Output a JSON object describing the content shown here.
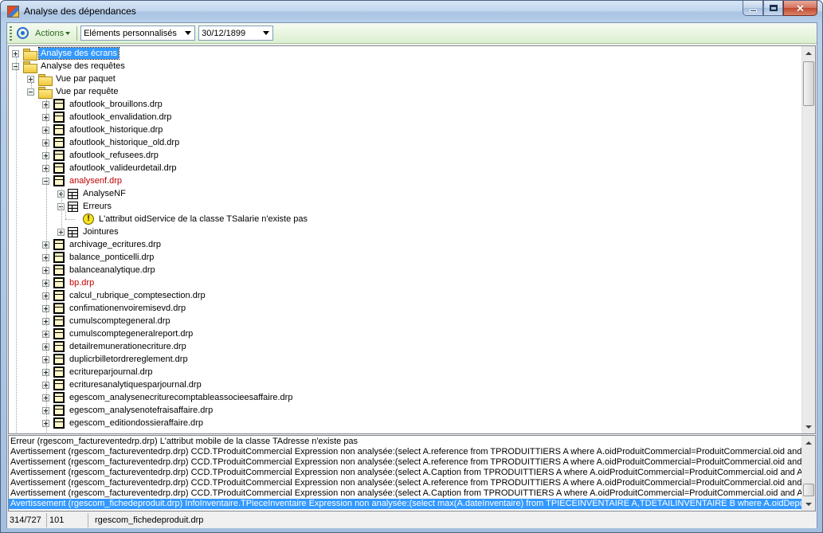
{
  "window": {
    "title": "Analyse des dépendances"
  },
  "toolbar": {
    "actions_label": "Actions",
    "filter_value": "Eléments personnalisés",
    "date_value": "30/12/1899"
  },
  "tree": {
    "nodes": [
      {
        "label": "Analyse des écrans",
        "level": 0,
        "expander": "plus",
        "icon": "folder",
        "selected": true
      },
      {
        "label": "Analyse des requêtes",
        "level": 0,
        "expander": "minus",
        "icon": "folder"
      },
      {
        "label": "Vue par paquet",
        "level": 1,
        "expander": "plus",
        "icon": "folder"
      },
      {
        "label": "Vue par requête",
        "level": 1,
        "expander": "minus",
        "icon": "folder"
      },
      {
        "label": "afoutlook_brouillons.drp",
        "level": 2,
        "expander": "plus",
        "icon": "table"
      },
      {
        "label": "afoutlook_envalidation.drp",
        "level": 2,
        "expander": "plus",
        "icon": "table"
      },
      {
        "label": "afoutlook_historique.drp",
        "level": 2,
        "expander": "plus",
        "icon": "table"
      },
      {
        "label": "afoutlook_historique_old.drp",
        "level": 2,
        "expander": "plus",
        "icon": "table"
      },
      {
        "label": "afoutlook_refusees.drp",
        "level": 2,
        "expander": "plus",
        "icon": "table"
      },
      {
        "label": "afoutlook_valideurdetail.drp",
        "level": 2,
        "expander": "plus",
        "icon": "table"
      },
      {
        "label": "analysenf.drp",
        "level": 2,
        "expander": "minus",
        "icon": "table",
        "red": true
      },
      {
        "label": "AnalyseNF",
        "level": 3,
        "expander": "plus",
        "icon": "grid"
      },
      {
        "label": "Erreurs",
        "level": 3,
        "expander": "minus",
        "icon": "grid"
      },
      {
        "label": "L'attribut oidService de la classe TSalarie n'existe pas",
        "level": 4,
        "expander": "none",
        "icon": "warning"
      },
      {
        "label": "Jointures",
        "level": 3,
        "expander": "plus",
        "icon": "grid"
      },
      {
        "label": "archivage_ecritures.drp",
        "level": 2,
        "expander": "plus",
        "icon": "table"
      },
      {
        "label": "balance_ponticelli.drp",
        "level": 2,
        "expander": "plus",
        "icon": "table"
      },
      {
        "label": "balanceanalytique.drp",
        "level": 2,
        "expander": "plus",
        "icon": "table"
      },
      {
        "label": "bp.drp",
        "level": 2,
        "expander": "plus",
        "icon": "table",
        "red": true
      },
      {
        "label": "calcul_rubrique_comptesection.drp",
        "level": 2,
        "expander": "plus",
        "icon": "table"
      },
      {
        "label": "confimationenvoiremisevd.drp",
        "level": 2,
        "expander": "plus",
        "icon": "table"
      },
      {
        "label": "cumulscomptegeneral.drp",
        "level": 2,
        "expander": "plus",
        "icon": "table"
      },
      {
        "label": "cumulscomptegeneralreport.drp",
        "level": 2,
        "expander": "plus",
        "icon": "table"
      },
      {
        "label": "detailremunerationecriture.drp",
        "level": 2,
        "expander": "plus",
        "icon": "table"
      },
      {
        "label": "duplicrbilletordrereglement.drp",
        "level": 2,
        "expander": "plus",
        "icon": "table"
      },
      {
        "label": "ecritureparjournal.drp",
        "level": 2,
        "expander": "plus",
        "icon": "table"
      },
      {
        "label": "ecrituresanalytiquesparjournal.drp",
        "level": 2,
        "expander": "plus",
        "icon": "table"
      },
      {
        "label": "egescom_analysenecriturecomptableassocieesaffaire.drp",
        "level": 2,
        "expander": "plus",
        "icon": "table"
      },
      {
        "label": "egescom_analysenotefraisaffaire.drp",
        "level": 2,
        "expander": "plus",
        "icon": "table"
      },
      {
        "label": "egescom_editiondossieraffaire.drp",
        "level": 2,
        "expander": "plus",
        "icon": "table"
      }
    ]
  },
  "log": {
    "lines": [
      {
        "text": "Erreur (rgescom_factureventedrp.drp) L'attribut mobile de la classe TAdresse n'existe pas"
      },
      {
        "text": "Avertissement (rgescom_factureventedrp.drp) CCD.TProduitCommercial Expression non analysée:(select A.reference from TPRODUITTIERS A where A.oidProduitCommercial=ProduitCommercial.oid and A.oidRoleTiers"
      },
      {
        "text": "Avertissement (rgescom_factureventedrp.drp) CCD.TProduitCommercial Expression non analysée:(select A.reference from TPRODUITTIERS A where A.oidProduitCommercial=ProduitCommercial.oid and A.oidRoleTiers"
      },
      {
        "text": "Avertissement (rgescom_factureventedrp.drp) CCD.TProduitCommercial Expression non analysée:(select A.Caption from TPRODUITTIERS A where A.oidProduitCommercial=ProduitCommercial.oid and A.oidRoleTiers"
      },
      {
        "text": "Avertissement (rgescom_factureventedrp.drp) CCD.TProduitCommercial Expression non analysée:(select A.reference from TPRODUITTIERS A where A.oidProduitCommercial=ProduitCommercial.oid and A.oidRoleTiers"
      },
      {
        "text": "Avertissement (rgescom_factureventedrp.drp) CCD.TProduitCommercial Expression non analysée:(select A.Caption from TPRODUITTIERS A where A.oidProduitCommercial=ProduitCommercial.oid and A.oidRoleTiers"
      },
      {
        "text": "Avertissement (rgescom_fichedeproduit.drp) InfoInventaire.TPieceInventaire Expression non analysée:(select max(A.dateInventaire) from TPIECEINVENTAIRE A,TDETAILINVENTAIRE B where A.oidDepot=PiecesInventaire",
        "selected": true
      }
    ]
  },
  "statusbar": {
    "position": "314/727",
    "count": "101",
    "current": "rgescom_fichedeproduit.drp"
  }
}
